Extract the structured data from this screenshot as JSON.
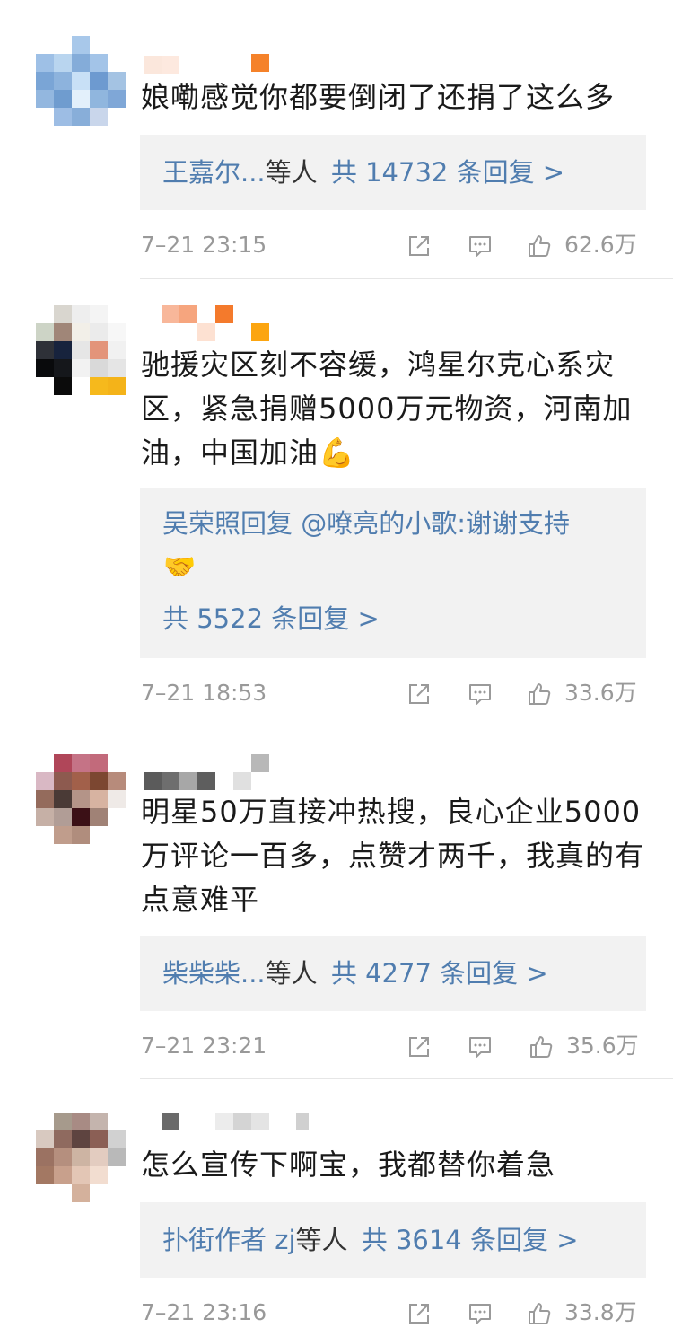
{
  "colors": {
    "link": "#507daf",
    "text": "#1a1a1a",
    "muted": "#999999",
    "box": "#f2f2f2"
  },
  "comments": [
    {
      "text": "娘嘞感觉你都要倒闭了还捐了这么多",
      "reply": {
        "names": "王嘉尔...",
        "suffix": "等人",
        "count": "共 14732 条回复 >"
      },
      "time": "7–21 23:15",
      "likes": "62.6万"
    },
    {
      "text": "驰援灾区刻不容缓，鸿星尔克心系灾区，紧急捐赠5000万元物资，河南加油，中国加油💪",
      "reply": {
        "line1": "吴荣照回复 @嘹亮的小歌:谢谢支持",
        "emoji": "🤝",
        "count": "共 5522 条回复 >"
      },
      "time": "7–21 18:53",
      "likes": "33.6万"
    },
    {
      "text": "明星50万直接冲热搜，良心企业5000万评论一百多，点赞才两千，我真的有点意难平",
      "reply": {
        "names": "柴柴柴...",
        "suffix": "等人",
        "count": "共 4277 条回复 >"
      },
      "time": "7–21 23:21",
      "likes": "35.6万"
    },
    {
      "text": "怎么宣传下啊宝，我都替你着急",
      "reply": {
        "names": "扑街作者 zj",
        "suffix": "等人",
        "count": "共 3614 条回复 >"
      },
      "time": "7–21 23:16",
      "likes": "33.8万"
    }
  ],
  "icons": {
    "share": "share-icon",
    "comment": "comment-icon",
    "like": "thumbs-up-icon"
  }
}
